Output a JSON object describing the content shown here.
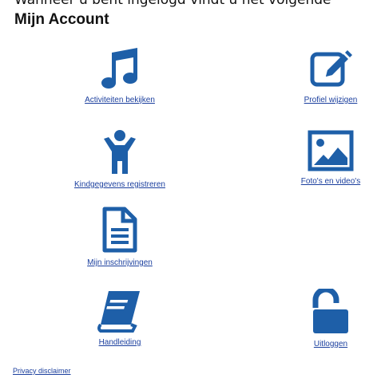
{
  "intro_text": "Wanneer u bent ingelogd vindt u het volgende",
  "page_title": "Mijn Account",
  "colors": {
    "icon": "#1e5fa8",
    "link": "#1b3f9e"
  },
  "tiles": [
    {
      "label": "Activiteiten bekijken",
      "icon": "music-note-icon"
    },
    {
      "label": "Profiel wijzigen",
      "icon": "edit-icon"
    },
    {
      "label": "Kindgegevens registreren",
      "icon": "child-icon"
    },
    {
      "label": "Foto's en video's",
      "icon": "photo-icon"
    },
    {
      "label": "Mijn inschrijvingen",
      "icon": "document-icon"
    },
    {
      "label": "Handleiding",
      "icon": "book-icon"
    },
    {
      "label": "Uitloggen",
      "icon": "unlock-icon"
    }
  ],
  "footer": {
    "privacy_label": "Privacy disclaimer"
  }
}
